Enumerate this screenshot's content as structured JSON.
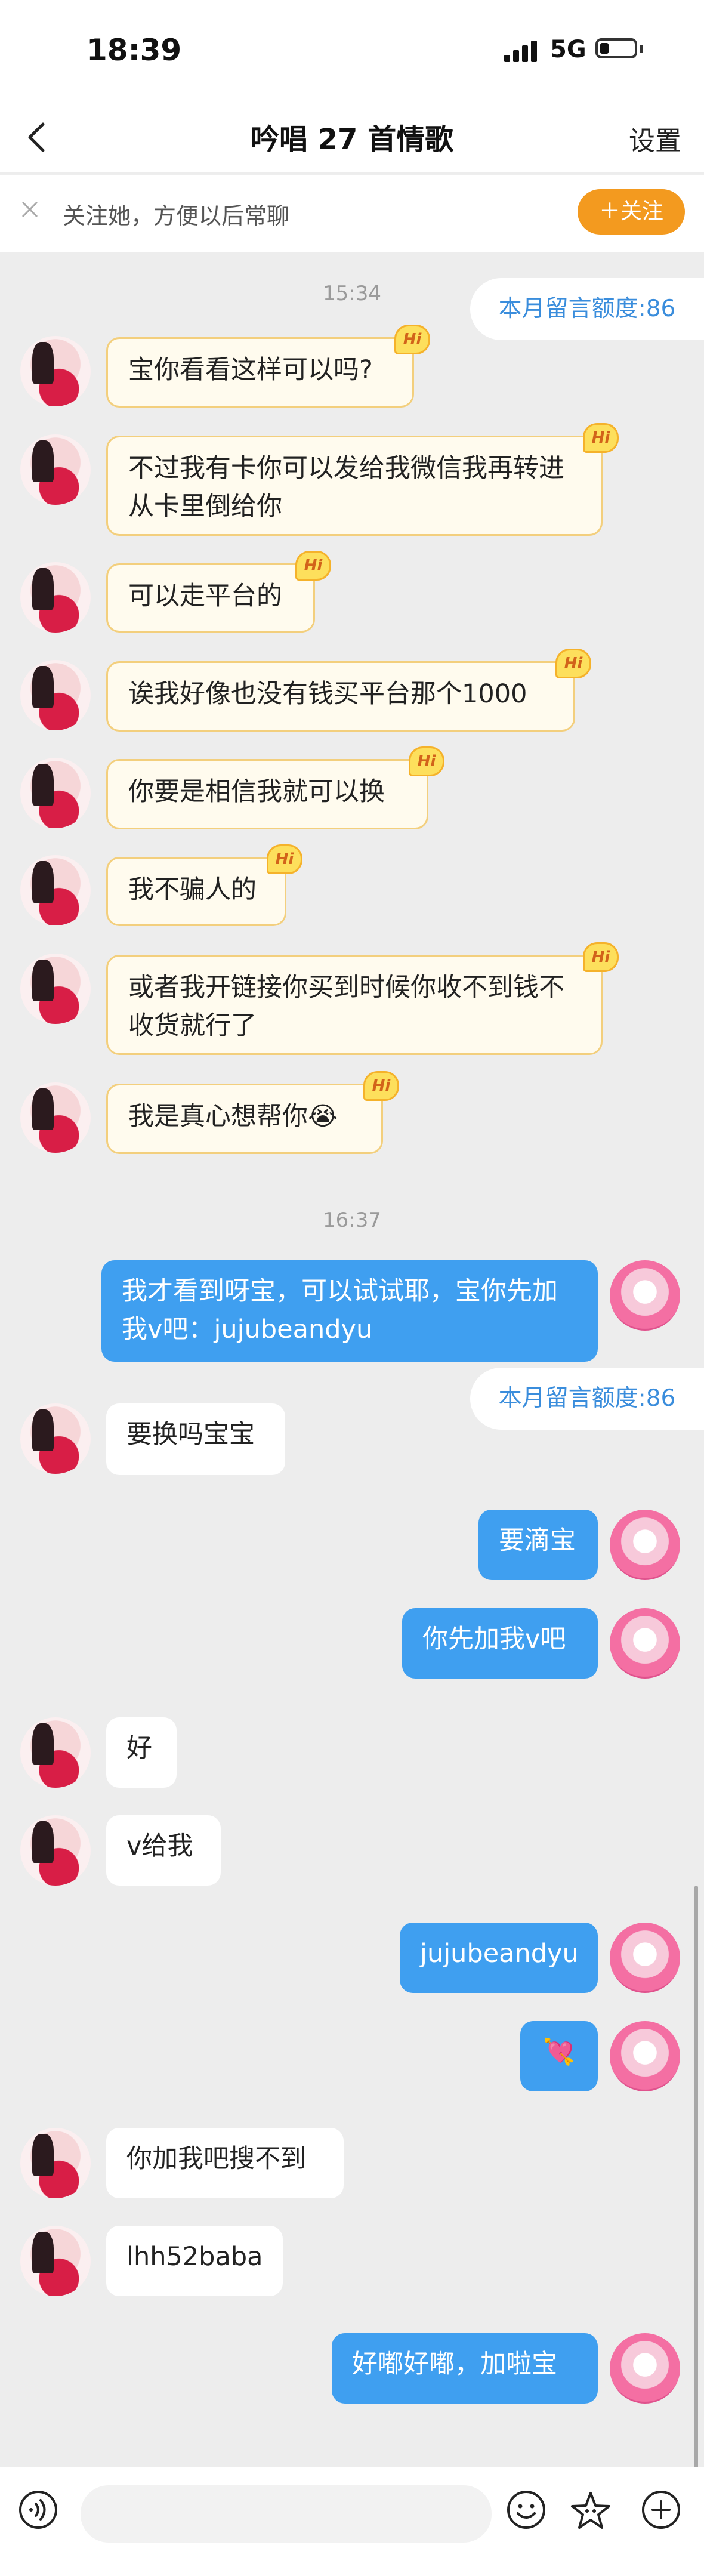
{
  "status_bar": {
    "time": "18:39",
    "network": "5G"
  },
  "nav": {
    "title": "吟唱 27 首情歌",
    "settings_label": "设置"
  },
  "banner": {
    "text": "关注她，方便以后常聊",
    "follow_button": "＋关注"
  },
  "hi_badge": "Hi",
  "messages": [
    {
      "type": "timestamp",
      "text": "15:34"
    },
    {
      "type": "quota",
      "text": "本月留言额度:86"
    },
    {
      "type": "received",
      "text": "宝你看看这样可以吗?"
    },
    {
      "type": "received",
      "text": "不过我有卡你可以发给我微信我再转进从卡里倒给你"
    },
    {
      "type": "received",
      "text": "可以走平台的"
    },
    {
      "type": "received",
      "text": "诶我好像也没有钱买平台那个1000"
    },
    {
      "type": "received",
      "text": "你要是相信我就可以换"
    },
    {
      "type": "received",
      "text": "我不骗人的"
    },
    {
      "type": "received",
      "text": "或者我开链接你买到时候你收不到钱不收货就行了"
    },
    {
      "type": "received",
      "text": "我是真心想帮你😭"
    },
    {
      "type": "timestamp",
      "text": "16:37"
    },
    {
      "type": "sent",
      "text": "我才看到呀宝，可以试试耶，宝你先加我v吧：jujubeandyu"
    },
    {
      "type": "quota",
      "text": "本月留言额度:86"
    },
    {
      "type": "received",
      "text": "要换吗宝宝"
    },
    {
      "type": "sent",
      "text": "要滴宝"
    },
    {
      "type": "sent",
      "text": "你先加我v吧"
    },
    {
      "type": "received",
      "text": "好"
    },
    {
      "type": "received",
      "text": "v给我"
    },
    {
      "type": "sent",
      "text": "jujubeandyu"
    },
    {
      "type": "sent",
      "text": "💘"
    },
    {
      "type": "received",
      "text": "你加我吧搜不到"
    },
    {
      "type": "received",
      "text": "lhh52baba"
    },
    {
      "type": "sent",
      "text": "好嘟好嘟，加啦宝"
    }
  ],
  "input": {
    "placeholder": ""
  },
  "icons": {
    "back": "chevron-left-icon",
    "close": "close-icon",
    "voice": "voice-icon",
    "emoji": "emoji-icon",
    "star": "star-icon",
    "plus": "plus-icon"
  },
  "colors": {
    "sent_bubble": "#3f9ff0",
    "follow_button": "#f39a1f",
    "quota_text": "#3a8ddc",
    "background": "#ededed"
  }
}
